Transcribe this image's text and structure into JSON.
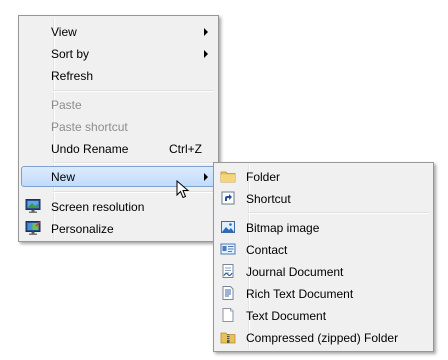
{
  "context_menu": {
    "items": [
      {
        "label": "View"
      },
      {
        "label": "Sort by"
      },
      {
        "label": "Refresh"
      },
      {
        "label": "Paste"
      },
      {
        "label": "Paste shortcut"
      },
      {
        "label": "Undo Rename",
        "shortcut": "Ctrl+Z"
      },
      {
        "label": "New"
      },
      {
        "label": "Screen resolution"
      },
      {
        "label": "Personalize"
      }
    ]
  },
  "new_submenu": {
    "items": [
      {
        "label": "Folder"
      },
      {
        "label": "Shortcut"
      },
      {
        "label": "Bitmap image"
      },
      {
        "label": "Contact"
      },
      {
        "label": "Journal Document"
      },
      {
        "label": "Rich Text Document"
      },
      {
        "label": "Text Document"
      },
      {
        "label": "Compressed (zipped) Folder"
      }
    ]
  },
  "colors": {
    "menu_background": "#f0f0f0",
    "menu_border": "#979797",
    "highlight_top": "#dcebfc",
    "highlight_bottom": "#c1dbfc",
    "highlight_border": "#7da2ce",
    "disabled_text": "#8d8d8d"
  },
  "icons": [
    "monitor-icon",
    "personalize-icon",
    "folder-icon",
    "shortcut-icon",
    "bitmap-icon",
    "contact-icon",
    "journal-icon",
    "rich-text-icon",
    "text-document-icon",
    "zip-folder-icon",
    "mouse-cursor-icon"
  ]
}
